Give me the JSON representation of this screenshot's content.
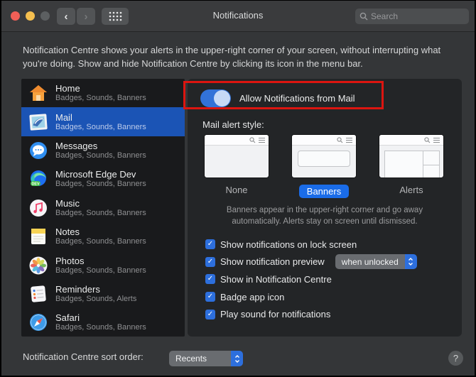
{
  "titlebar": {
    "title": "Notifications",
    "search_placeholder": "Search",
    "back_glyph": "‹",
    "forward_glyph": "›"
  },
  "description": "Notification Centre shows your alerts in the upper-right corner of your screen, without interrupting what you're doing. Show and hide Notification Centre by clicking its icon in the menu bar.",
  "sidebar": {
    "items": [
      {
        "name": "Home",
        "subtitle": "Badges, Sounds, Banners",
        "selected": false
      },
      {
        "name": "Mail",
        "subtitle": "Badges, Sounds, Banners",
        "selected": true
      },
      {
        "name": "Messages",
        "subtitle": "Badges, Sounds, Banners",
        "selected": false
      },
      {
        "name": "Microsoft Edge Dev",
        "subtitle": "Badges, Sounds, Banners",
        "selected": false
      },
      {
        "name": "Music",
        "subtitle": "Badges, Sounds, Banners",
        "selected": false
      },
      {
        "name": "Notes",
        "subtitle": "Badges, Sounds, Banners",
        "selected": false
      },
      {
        "name": "Photos",
        "subtitle": "Badges, Sounds, Banners",
        "selected": false
      },
      {
        "name": "Reminders",
        "subtitle": "Badges, Sounds, Alerts",
        "selected": false
      },
      {
        "name": "Safari",
        "subtitle": "Badges, Sounds, Banners",
        "selected": false
      }
    ]
  },
  "main": {
    "toggle_label": "Allow Notifications from Mail",
    "toggle_on": true,
    "alert_style": {
      "label": "Mail alert style:",
      "options": [
        {
          "label": "None",
          "selected": false
        },
        {
          "label": "Banners",
          "selected": true
        },
        {
          "label": "Alerts",
          "selected": false
        }
      ],
      "caption_line1": "Banners appear in the upper-right corner and go away",
      "caption_line2": "automatically. Alerts stay on screen until dismissed."
    },
    "checkboxes": [
      {
        "label": "Show notifications on lock screen",
        "checked": true
      },
      {
        "label": "Show notification preview",
        "checked": true
      },
      {
        "label": "Show in Notification Centre",
        "checked": true
      },
      {
        "label": "Badge app icon",
        "checked": true
      },
      {
        "label": "Play sound for notifications",
        "checked": true
      }
    ],
    "preview_dropdown_value": "when unlocked",
    "check_glyph": "✓"
  },
  "footer": {
    "sort_label": "Notification Centre sort order:",
    "sort_value": "Recents",
    "help_glyph": "?"
  },
  "colors": {
    "accent_blue": "#2d6fdd",
    "selection_blue": "#1b54b5",
    "annotation_red": "#dc1510",
    "panel_bg": "#232527",
    "sidebar_bg": "#191a1c",
    "window_bg": "#343638"
  }
}
